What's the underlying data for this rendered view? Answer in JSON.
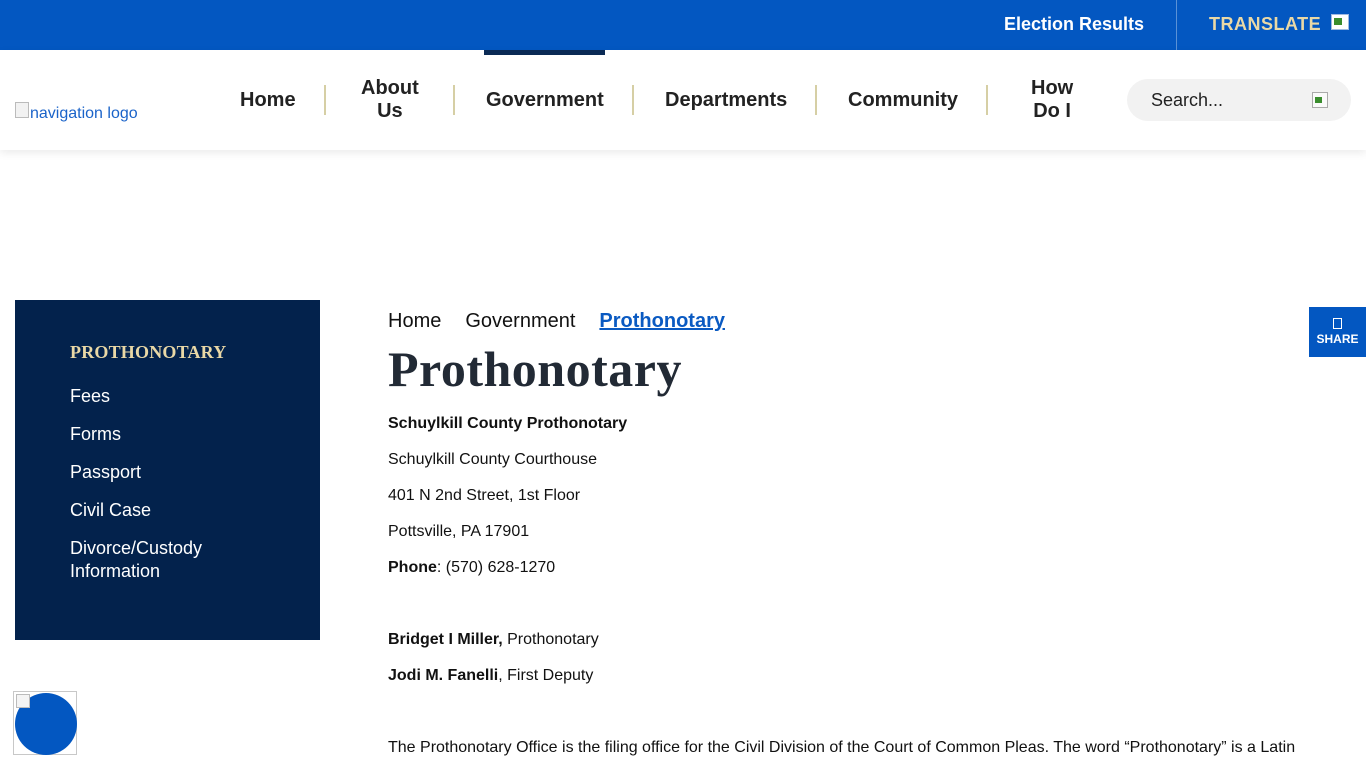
{
  "topbar": {
    "election_results": "Election Results",
    "translate": "TRANSLATE",
    "translate_icon": "flag-icon"
  },
  "nav": {
    "logo_alt": "navigation logo",
    "items": [
      {
        "label": "Home"
      },
      {
        "label": "About\nUs"
      },
      {
        "label": "Government"
      },
      {
        "label": "Departments"
      },
      {
        "label": "Community"
      },
      {
        "label": "How\nDo I"
      }
    ],
    "search_placeholder": "Search..."
  },
  "sidebar": {
    "title": "PROTHONOTARY",
    "links": [
      "Fees",
      "Forms",
      "Passport",
      "Civil Case",
      "Divorce/Custody Information"
    ]
  },
  "breadcrumb": {
    "home": "Home",
    "government": "Government",
    "current": "Prothonotary"
  },
  "page": {
    "title": "Prothonotary",
    "office_name": "Schuylkill County Prothonotary",
    "building": "Schuylkill County Courthouse",
    "street": "401 N 2nd Street, 1st Floor",
    "city": "Pottsville, PA 17901",
    "phone_label": "Phone",
    "phone_value": ": (570) 628-1270",
    "person1_name": "Bridget I Miller,",
    "person1_role": " Prothonotary",
    "person2_name": "Jodi M. Fanelli",
    "person2_role": ", First Deputy",
    "description": "The Prothonotary Office is the filing office for the Civil Division of the Court of Common Pleas. The word “Prothonotary” is a Latin"
  },
  "share": {
    "label": "SHARE",
    "icon": "share-icon"
  },
  "colors": {
    "topbar_blue": "#0357c1",
    "sidebar_navy": "#03224c",
    "gold": "#e9d8a6",
    "link_blue": "#0a5ac2"
  }
}
